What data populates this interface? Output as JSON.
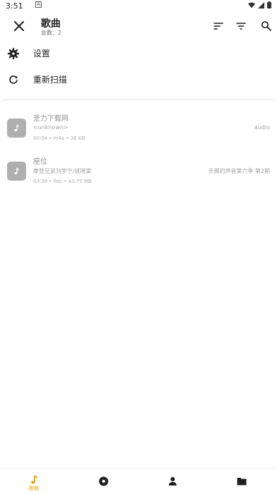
{
  "status_bar": {
    "time": "3:51",
    "a_icon": "A"
  },
  "app_bar": {
    "title": "歌曲",
    "subtitle": "总数：2",
    "icons": [
      "close-icon",
      "sort-icon",
      "filter-icon",
      "search-icon"
    ]
  },
  "menu": [
    {
      "label": "设置",
      "icon": "gear-icon"
    },
    {
      "label": "重新扫描",
      "icon": "refresh-icon"
    }
  ],
  "songs": [
    {
      "title": "圣力下载网",
      "artist": "<unknown>",
      "album": "audio",
      "meta": "00:04 • m4a • 36 KB",
      "icon": "music-note-icon"
    },
    {
      "title": "座位",
      "artist": "摩登兄弟刘宇宁/姚晓棠",
      "album": "天赐的声音第六季 第2期",
      "meta": "03:38 • flac • 43.75 MB",
      "icon": "music-note-icon"
    }
  ],
  "bottom_nav": [
    {
      "label": "歌曲",
      "icon": "music-note-icon",
      "active": true
    },
    {
      "label": "",
      "icon": "album-icon",
      "active": false
    },
    {
      "label": "",
      "icon": "person-icon",
      "active": false
    },
    {
      "label": "",
      "icon": "folder-icon",
      "active": false
    }
  ],
  "colors": {
    "accent": "#e6a100",
    "icon_dark": "#1f1f1f",
    "cover": "#6f6f6f"
  }
}
